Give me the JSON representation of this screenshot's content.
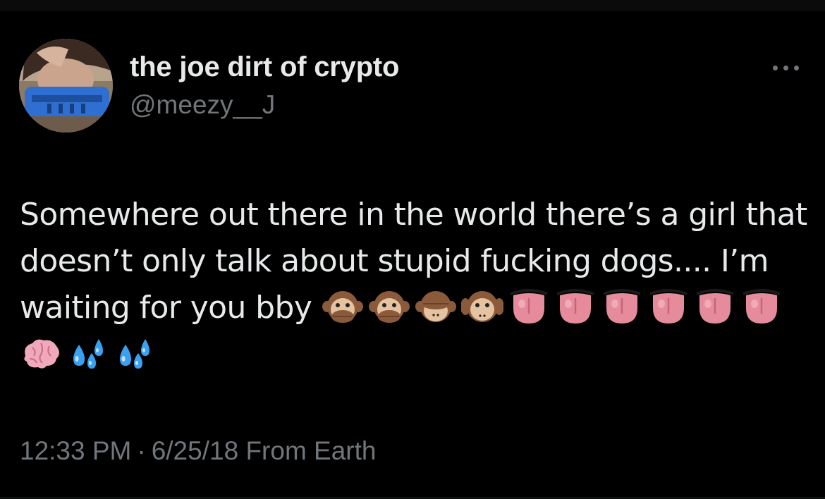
{
  "tweet": {
    "display_name": "the joe dirt of crypto",
    "handle": "@meezy__J",
    "text": "Somewhere out there in the world there’s a girl that doesn’t only talk about stupid fucking dogs.... I’m waiting for you bby ",
    "emojis": [
      "speak-no-evil-monkey",
      "speak-no-evil-monkey",
      "see-no-evil-monkey",
      "hear-no-evil-monkey",
      "tongue",
      "tongue",
      "tongue",
      "tongue",
      "tongue",
      "tongue",
      "brain",
      "sweat-droplets",
      "sweat-droplets"
    ],
    "time": "12:33 PM",
    "separator": "·",
    "date": "6/25/18",
    "source": "From Earth"
  },
  "icons": {
    "more": "more-horizontal-icon"
  },
  "colors": {
    "background": "#000000",
    "primary_text": "#e7e9ea",
    "secondary_text": "#71767b"
  }
}
